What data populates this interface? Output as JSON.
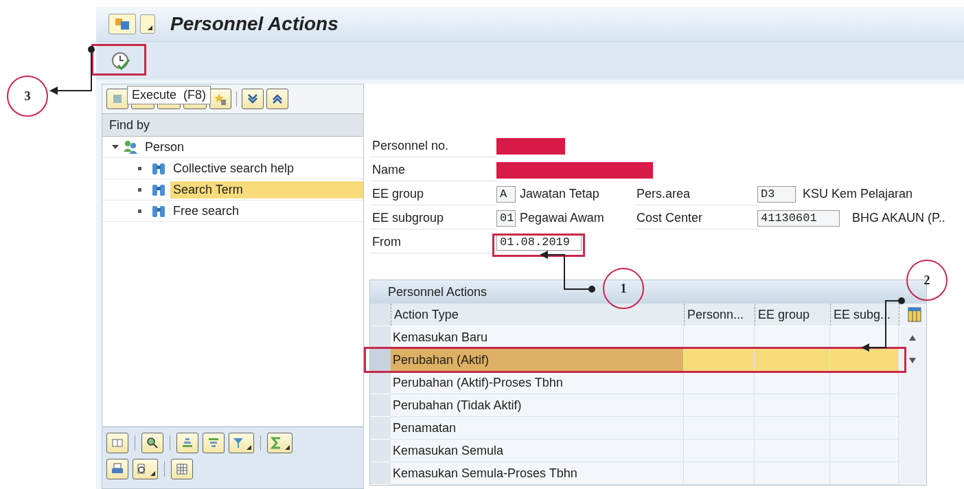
{
  "window": {
    "title": "Personnel Actions"
  },
  "tooltip": "Execute  (F8)",
  "find_by": {
    "header": "Find by",
    "tree": [
      {
        "label": "Person",
        "expanded": true,
        "children": [
          {
            "label": "Collective search help",
            "selected": false
          },
          {
            "label": "Search Term",
            "selected": true
          },
          {
            "label": "Free search",
            "selected": false
          }
        ]
      }
    ]
  },
  "header": {
    "personnel_no_label": "Personnel no.",
    "name_label": "Name",
    "ee_group": {
      "label": "EE group",
      "code": "A",
      "text": "Jawatan Tetap"
    },
    "pers_area": {
      "label": "Pers.area",
      "code": "D3",
      "text": "KSU Kem Pelajaran"
    },
    "ee_subgroup": {
      "label": "EE subgroup",
      "code": "01",
      "text": "Pegawai Awam"
    },
    "cost_center": {
      "label": "Cost Center",
      "code": "41130601",
      "text": "BHG AKAUN (P.."
    },
    "from": {
      "label": "From",
      "value": "01.08.2019"
    }
  },
  "table": {
    "title": "Personnel Actions",
    "columns": [
      "Action Type",
      "Personn...",
      "EE group",
      "EE subg..."
    ],
    "rows": [
      {
        "action_type": "Kemasukan Baru",
        "selected": false
      },
      {
        "action_type": "Perubahan (Aktif)",
        "selected": true
      },
      {
        "action_type": "Perubahan (Aktif)-Proses Tbhn",
        "selected": false
      },
      {
        "action_type": "Perubahan (Tidak Aktif)",
        "selected": false
      },
      {
        "action_type": "Penamatan",
        "selected": false
      },
      {
        "action_type": "Kemasukan Semula",
        "selected": false
      },
      {
        "action_type": "Kemasukan Semula-Proses Tbhn",
        "selected": false
      }
    ]
  },
  "annotations": [
    {
      "number": "3"
    },
    {
      "number": "1"
    },
    {
      "number": "2"
    }
  ]
}
